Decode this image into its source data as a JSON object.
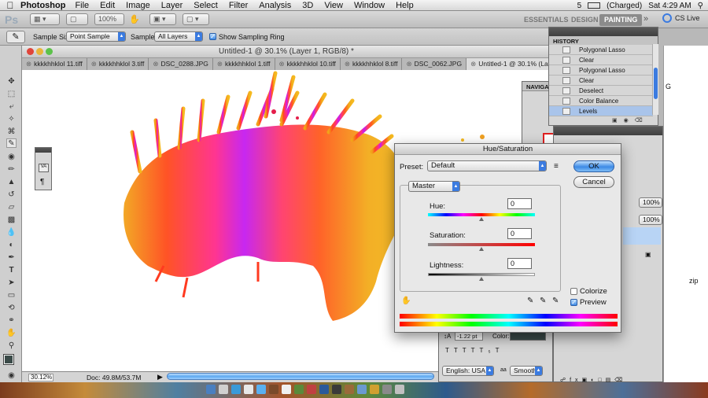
{
  "menubar": {
    "app": "Photoshop",
    "items": [
      "File",
      "Edit",
      "Image",
      "Layer",
      "Select",
      "Filter",
      "Analysis",
      "3D",
      "View",
      "Window",
      "Help"
    ],
    "battery": "(Charged)",
    "clock": "Sat 4:29 AM",
    "badge": "5"
  },
  "appbar": {
    "logo": "Ps",
    "zoom": "100%",
    "workspaces": [
      "ESSENTIALS",
      "DESIGN",
      "PAINTING"
    ],
    "active_workspace": "PAINTING",
    "more": "»",
    "cs_live": "CS Live"
  },
  "options": {
    "sample_size_label": "Sample Size:",
    "sample_size_value": "Point Sample",
    "sample_label": "Sample:",
    "sample_value": "All Layers",
    "show_ring_label": "Show Sampling Ring"
  },
  "document": {
    "title": "Untitled-1 @ 30.1% (Layer 1, RGB/8) *",
    "tabs": [
      "kkkkhhklol 11.tiff",
      "kkkkhhklol 3.tiff",
      "DSC_0288.JPG",
      "kkkkhhklol 1.tiff",
      "kkkkhhklol 10.tiff",
      "kkkkhhklol 8.tiff",
      "DSC_0062.JPG",
      "Untitled-1 @ 30.1% (Layer 1, RGB/8) *"
    ],
    "zoom_status": "30.12%",
    "doc_size": "Doc: 49.8M/53.7M"
  },
  "history": {
    "title": "HISTORY",
    "items": [
      "Polygonal Lasso",
      "Clear",
      "Polygonal Lasso",
      "Clear",
      "Deselect",
      "Color Balance",
      "Levels"
    ],
    "selected_index": 6
  },
  "navigator": {
    "title": "NAVIGATO"
  },
  "hue_saturation": {
    "title": "Hue/Saturation",
    "preset_label": "Preset:",
    "preset_value": "Default",
    "channel": "Master",
    "hue_label": "Hue:",
    "hue_value": "0",
    "saturation_label": "Saturation:",
    "saturation_value": "0",
    "lightness_label": "Lightness:",
    "lightness_value": "0",
    "ok": "OK",
    "cancel": "Cancel",
    "colorize_label": "Colorize",
    "colorize": false,
    "preview_label": "Preview",
    "preview": true
  },
  "character": {
    "tracking": "-1.22 pt",
    "color_label": "Color:",
    "language": "English: USA",
    "aa_label": "aa",
    "antialias": "Smooth"
  },
  "layers": {
    "opacity": "100%",
    "fill": "100%"
  },
  "misc": {
    "zip": "zip",
    "glyph_g": "G"
  }
}
